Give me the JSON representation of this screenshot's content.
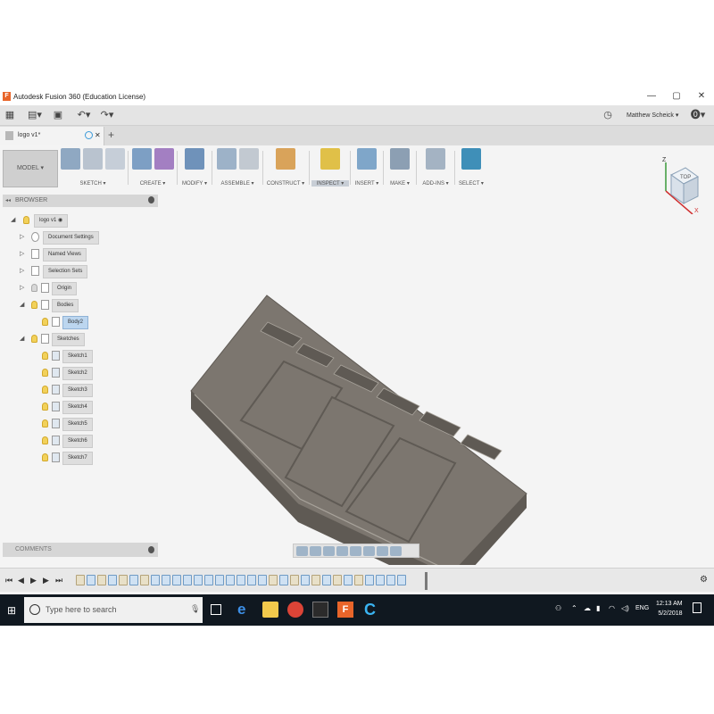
{
  "app": {
    "title": "Autodesk Fusion 360 (Education License)",
    "logo_letter": "F",
    "user": "Matthew Scheick ▾"
  },
  "window_controls": [
    "—",
    "▢",
    "✕"
  ],
  "document": {
    "tab_label": "logo v1*",
    "tab_close": "✕",
    "new_tab": "+"
  },
  "ribbon": {
    "workspace": "MODEL ▾",
    "groups": [
      {
        "label": "SKETCH ▾"
      },
      {
        "label": "CREATE ▾"
      },
      {
        "label": "MODIFY ▾"
      },
      {
        "label": "ASSEMBLE ▾"
      },
      {
        "label": "CONSTRUCT ▾"
      },
      {
        "label": "INSPECT ▾"
      },
      {
        "label": "INSERT ▾"
      },
      {
        "label": "MAKE ▾"
      },
      {
        "label": "ADD-INS ▾"
      },
      {
        "label": "SELECT ▾"
      }
    ],
    "active_group": "INSPECT ▾"
  },
  "browser": {
    "header": "BROWSER",
    "root": "logo v1",
    "items": [
      {
        "label": "Document Settings"
      },
      {
        "label": "Named Views"
      },
      {
        "label": "Selection Sets"
      },
      {
        "label": "Origin"
      },
      {
        "label": "Bodies"
      },
      {
        "label": "Body2"
      },
      {
        "label": "Sketches"
      },
      {
        "label": "Sketch1"
      },
      {
        "label": "Sketch2"
      },
      {
        "label": "Sketch3"
      },
      {
        "label": "Sketch4"
      },
      {
        "label": "Sketch5"
      },
      {
        "label": "Sketch6"
      },
      {
        "label": "Sketch7"
      }
    ]
  },
  "viewcube": {
    "face_label": "TOP",
    "axis_z": "Z",
    "axis_x": "X"
  },
  "comments": {
    "label": "COMMENTS"
  },
  "taskbar": {
    "search_placeholder": "Type here to search",
    "lang": "ENG",
    "time": "12:13 AM",
    "date": "5/2/2018"
  },
  "model": {
    "top_color": "#7c766f",
    "side_color": "#5f5a54",
    "edge_color": "#a8a39b"
  }
}
